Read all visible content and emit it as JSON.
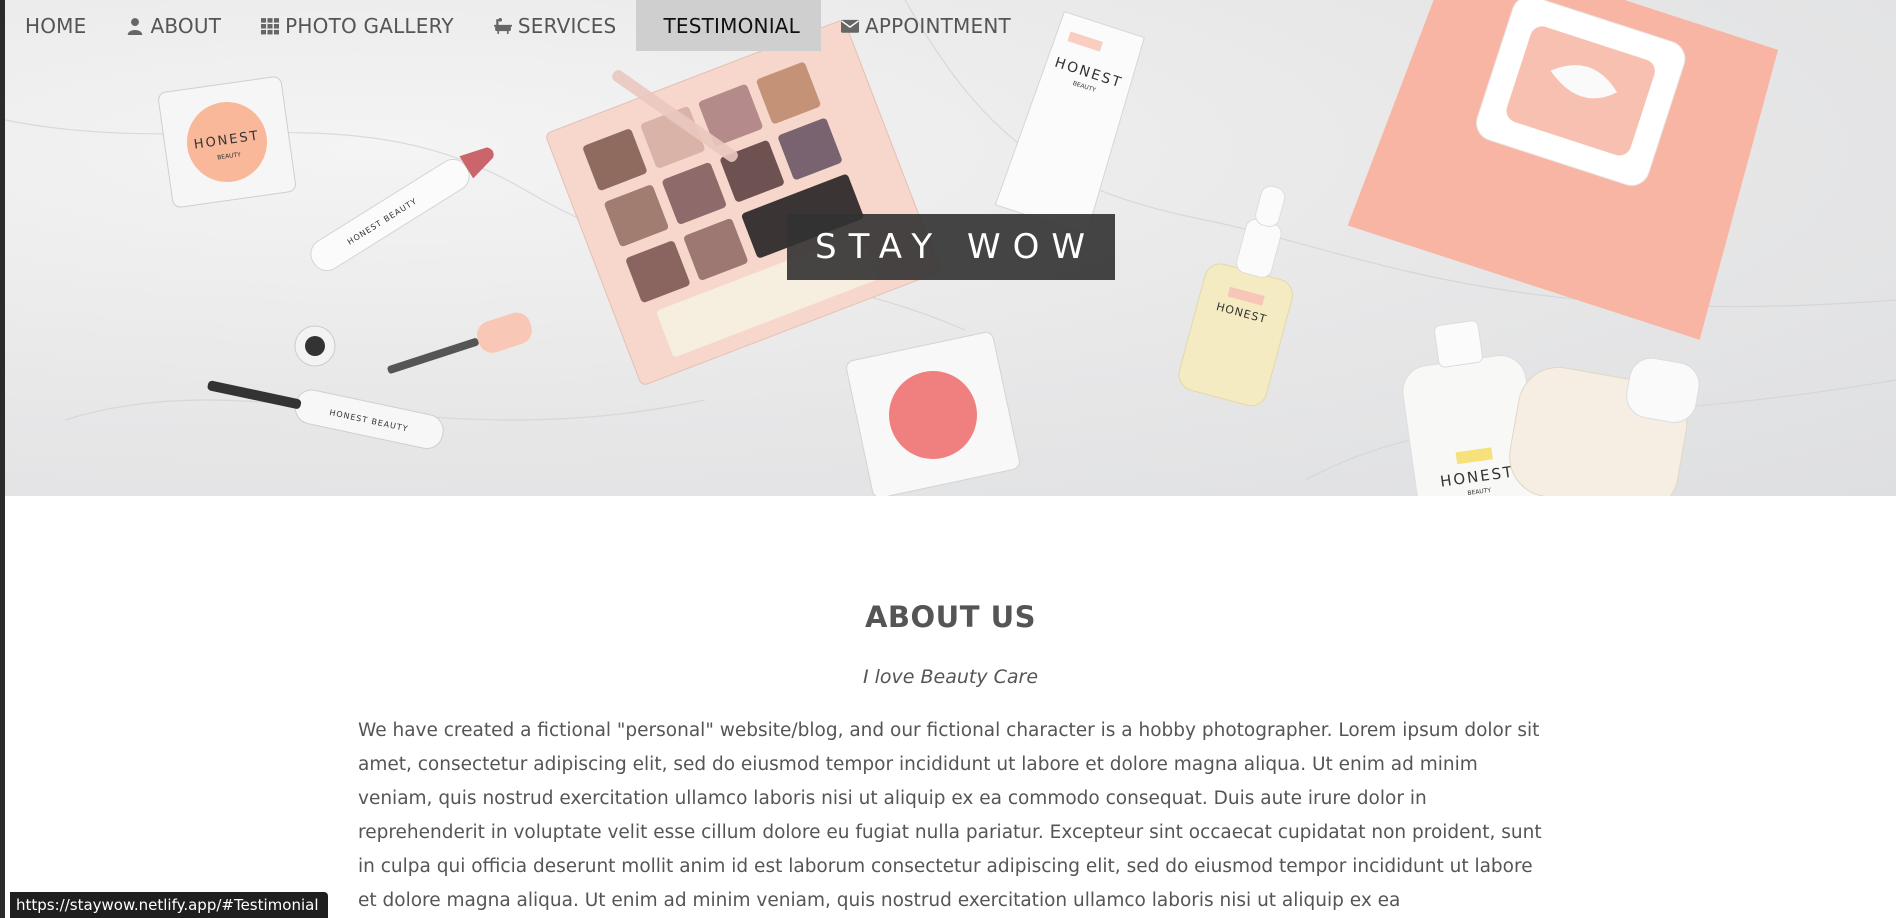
{
  "nav": {
    "items": [
      {
        "label": "HOME",
        "icon": "",
        "active": false
      },
      {
        "label": "ABOUT",
        "icon": "user-icon",
        "active": false
      },
      {
        "label": "PHOTO GALLERY",
        "icon": "grid-icon",
        "active": false
      },
      {
        "label": "SERVICES",
        "icon": "bath-icon",
        "active": false
      },
      {
        "label": "TESTIMONIAL",
        "icon": "",
        "active": true
      },
      {
        "label": "APPOINTMENT",
        "icon": "envelope-icon",
        "active": false
      }
    ]
  },
  "hero": {
    "title": "STAY WOW",
    "product_brand": "HONEST",
    "product_sub": "BEAUTY",
    "product_brand_long": "HONEST BEAUTY"
  },
  "about": {
    "title": "ABOUT US",
    "tagline": "I love Beauty Care",
    "body": "We have created a fictional \"personal\" website/blog, and our fictional character is a hobby photographer. Lorem ipsum dolor sit amet, consectetur adipiscing elit, sed do eiusmod tempor incididunt ut labore et dolore magna aliqua. Ut enim ad minim veniam, quis nostrud exercitation ullamco laboris nisi ut aliquip ex ea commodo consequat. Duis aute irure dolor in reprehenderit in voluptate velit esse cillum dolore eu fugiat nulla pariatur. Excepteur sint occaecat cupidatat non proident, sunt in culpa qui officia deserunt mollit anim id est laborum consectetur adipiscing elit, sed do eiusmod tempor incididunt ut labore et dolore magna aliqua. Ut enim ad minim veniam, quis nostrud exercitation ullamco laboris nisi ut aliquip ex ea"
  },
  "status_bar": {
    "url": "https://staywow.netlify.app/#Testimonial"
  },
  "colors": {
    "nav_active_bg": "#cfcfcf",
    "hero_title_bg": "#333333",
    "text": "#555555",
    "blush": "#f08080",
    "peach": "#f6b8a6"
  }
}
